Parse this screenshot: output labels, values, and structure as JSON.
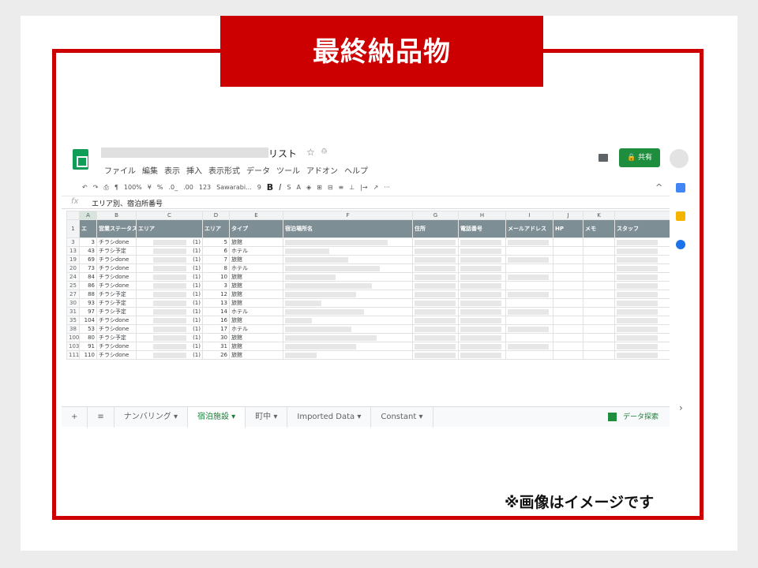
{
  "banner": "最終納品物",
  "note": "※画像はイメージです",
  "sheet": {
    "title_suffix": "リスト",
    "menu": [
      "ファイル",
      "編集",
      "表示",
      "挿入",
      "表示形式",
      "データ",
      "ツール",
      "アドオン",
      "ヘルプ"
    ],
    "share_label": "共有",
    "toolbar": {
      "zoom": "100%",
      "currency": "¥",
      "percent": "%",
      "dec1": ".0_",
      "dec2": ".00",
      "format": "123",
      "font": "Sawarabi...",
      "size": "9",
      "bold": "B",
      "italic": "I",
      "strike": "S",
      "color": "A",
      "more": "···"
    },
    "fx_value": "エリア別、宿泊所番号",
    "columns": [
      "A",
      "B",
      "C",
      "D",
      "E",
      "F",
      "G",
      "H",
      "I",
      "J",
      "K"
    ],
    "headers": [
      "エ",
      "営業ステータス",
      "エリア",
      "エリア",
      "タイプ",
      "宿泊場所名",
      "住所",
      "電話番号",
      "メールアドレス",
      "HP",
      "メモ",
      "スタッフ"
    ],
    "rows": [
      {
        "rn": "3",
        "a": "3",
        "b": "チラシdone",
        "c": "(1)",
        "d": "5",
        "e": "旅館"
      },
      {
        "rn": "13",
        "a": "43",
        "b": "チラシ予定",
        "c": "(1)",
        "d": "6",
        "e": "ホテル"
      },
      {
        "rn": "19",
        "a": "69",
        "b": "チラシdone",
        "c": "(1)",
        "d": "7",
        "e": "旅館"
      },
      {
        "rn": "20",
        "a": "73",
        "b": "チラシdone",
        "c": "(1)",
        "d": "8",
        "e": "ホテル"
      },
      {
        "rn": "24",
        "a": "84",
        "b": "チラシdone",
        "c": "(1)",
        "d": "10",
        "e": "旅館"
      },
      {
        "rn": "25",
        "a": "86",
        "b": "チラシdone",
        "c": "(1)",
        "d": "3",
        "e": "旅館"
      },
      {
        "rn": "27",
        "a": "88",
        "b": "チラシ予定",
        "c": "(1)",
        "d": "12",
        "e": "旅館"
      },
      {
        "rn": "30",
        "a": "93",
        "b": "チラシ予定",
        "c": "(1)",
        "d": "13",
        "e": "旅館"
      },
      {
        "rn": "31",
        "a": "97",
        "b": "チラシ予定",
        "c": "(1)",
        "d": "14",
        "e": "ホテル"
      },
      {
        "rn": "35",
        "a": "104",
        "b": "チラシdone",
        "c": "(1)",
        "d": "16",
        "e": "旅館"
      },
      {
        "rn": "38",
        "a": "53",
        "b": "チラシdone",
        "c": "(1)",
        "d": "17",
        "e": "ホテル"
      },
      {
        "rn": "100",
        "a": "80",
        "b": "チラシ予定",
        "c": "(1)",
        "d": "30",
        "e": "旅館"
      },
      {
        "rn": "103",
        "a": "91",
        "b": "チラシdone",
        "c": "(1)",
        "d": "31",
        "e": "旅館"
      },
      {
        "rn": "111",
        "a": "110",
        "b": "チラシdone",
        "c": "(1)",
        "d": "26",
        "e": "旅館"
      }
    ],
    "tabs": [
      "+",
      "≡",
      "ナンバリング ▾",
      "宿泊施設 ▾",
      "町中 ▾",
      "Imported Data ▾",
      "Constant ▾"
    ],
    "explore_label": "データ探索"
  },
  "colors": {
    "accent_red": "#cc0000",
    "sheets_green": "#1e8e3e"
  }
}
